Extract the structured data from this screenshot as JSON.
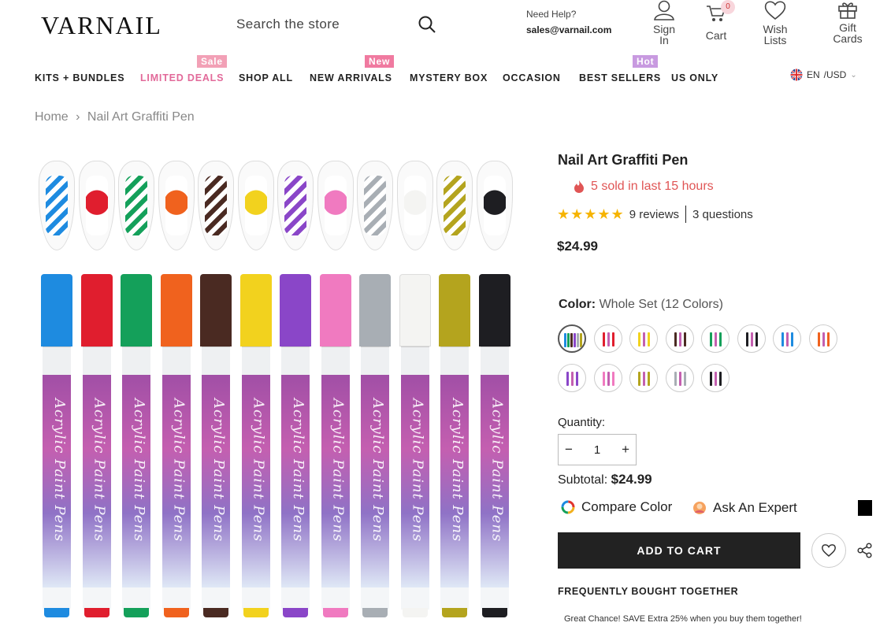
{
  "header": {
    "logo": "VARNAIL",
    "search_placeholder": "Search the store",
    "help_title": "Need Help?",
    "help_email": "sales@varnail.com",
    "sign_in": [
      "Sign",
      "In"
    ],
    "cart_label": "Cart",
    "cart_count": "0",
    "wish_lists": [
      "Wish",
      "Lists"
    ],
    "gift_cards": [
      "Gift",
      "Cards"
    ]
  },
  "nav": {
    "items": [
      {
        "label": "KITS + BUNDLES"
      },
      {
        "label": "LIMITED DEALS",
        "badge": "Sale"
      },
      {
        "label": "SHOP ALL"
      },
      {
        "label": "NEW ARRIVALS",
        "badge": "New"
      },
      {
        "label": "MYSTERY BOX"
      },
      {
        "label": "OCCASION"
      },
      {
        "label": "BEST SELLERS",
        "badge": "Hot"
      },
      {
        "label": "US ONLY"
      }
    ],
    "language": "EN",
    "currency": "/USD"
  },
  "breadcrumb": {
    "home": "Home",
    "separator": "›",
    "current": "Nail Art Graffiti Pen"
  },
  "product": {
    "title": "Nail Art Graffiti Pen",
    "sold_text": "5 sold in last 15 hours",
    "stars": "★★★★★",
    "reviews": "9 reviews",
    "questions": "3 questions",
    "price": "$24.99",
    "color_label": "Color:",
    "color_value": "Whole Set (12 Colors)",
    "quantity_label": "Quantity:",
    "quantity_value": "1",
    "qty_minus": "−",
    "qty_plus": "+",
    "subtotal_label": "Subtotal:",
    "subtotal_value": "$24.99",
    "compare_color": "Compare Color",
    "ask_expert": "Ask An Expert",
    "add_to_cart": "ADD TO CART",
    "fbt_title": "FREQUENTLY BOUGHT TOGETHER",
    "promo": "Great Chance! SAVE Extra 25% when you buy them together!",
    "pen_text": "Acrylic Paint Pens"
  },
  "pen_colors": [
    "#1e8be0",
    "#e01e2e",
    "#14a05a",
    "#f0621e",
    "#4a2a22",
    "#f2d21e",
    "#8a46c8",
    "#f07ac0",
    "#a8aeb4",
    "#f4f4f2",
    "#b4a41e",
    "#1e1e22"
  ],
  "swatch_colors": [
    "#c45fb0",
    "#e01e2e",
    "#f2d21e",
    "#4a2a22",
    "#14a05a",
    "#1e1e22",
    "#1e8be0",
    "#f0621e",
    "#8a46c8",
    "#f07ac0",
    "#b4a41e",
    "#a8aeb4",
    "#1e1e22"
  ]
}
